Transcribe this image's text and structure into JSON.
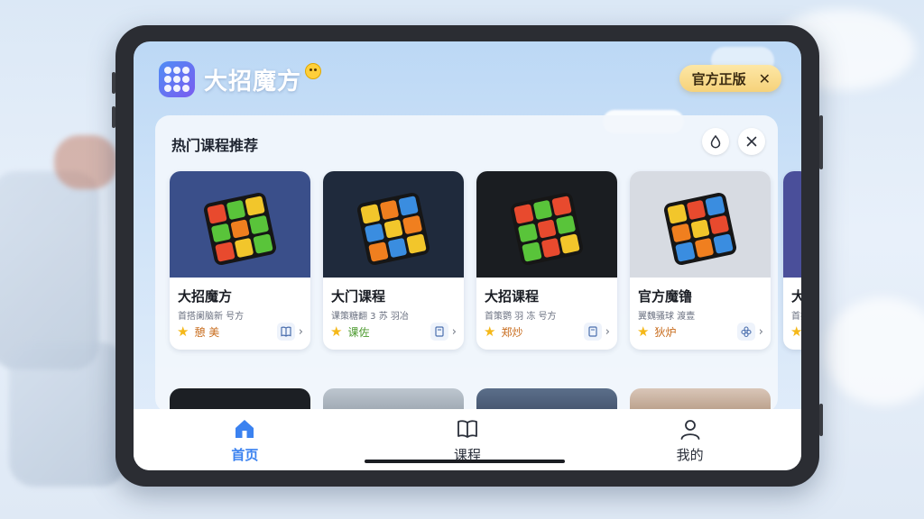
{
  "app": {
    "title": "大招魔方",
    "badge_label": "官方正版",
    "badge_close": "✕"
  },
  "section": {
    "title": "热门课程推荐"
  },
  "cards": [
    {
      "title": "大招魔方",
      "desc": "首搭阑脑新 号方",
      "tag": "憩 美",
      "tag_color": "#c76a1a",
      "icon": "book-open-icon",
      "bg": "#3a4f8a",
      "colors": [
        "#e84a2e",
        "#59c43a",
        "#f2c62b",
        "#59c43a",
        "#f07f1f",
        "#59c43a",
        "#e84a2e",
        "#f2c62b",
        "#59c43a"
      ]
    },
    {
      "title": "大门课程",
      "desc": "课策糖翻 3 苏 羽冶",
      "tag": "课佐",
      "tag_color": "#4c9a2e",
      "icon": "book-icon",
      "bg": "#1f2a3c",
      "colors": [
        "#f2c62b",
        "#f07f1f",
        "#3a8de0",
        "#3a8de0",
        "#f2c62b",
        "#f07f1f",
        "#f07f1f",
        "#3a8de0",
        "#f2c62b"
      ]
    },
    {
      "title": "大招课程",
      "desc": "首策鹦 羽 冻 号方",
      "tag": "郑炒",
      "tag_color": "#c76a1a",
      "icon": "book-icon",
      "bg": "#1a1d21",
      "colors": [
        "#e84a2e",
        "#59c43a",
        "#e84a2e",
        "#59c43a",
        "#e84a2e",
        "#59c43a",
        "#59c43a",
        "#e84a2e",
        "#f2c62b"
      ]
    },
    {
      "title": "官方魔镥",
      "desc": "翼魏骚球 渡壹",
      "tag": "狄炉",
      "tag_color": "#c76a1a",
      "icon": "flower-icon",
      "bg": "#d7dbe2",
      "colors": [
        "#f2c62b",
        "#e84a2e",
        "#3a8de0",
        "#f07f1f",
        "#f2c62b",
        "#e84a2e",
        "#3a8de0",
        "#f07f1f",
        "#3a8de0"
      ]
    }
  ],
  "partial_card": {
    "title": "大招",
    "desc": "首挡"
  },
  "nav": [
    {
      "label": "首页",
      "icon": "home-icon",
      "active": true
    },
    {
      "label": "课程",
      "icon": "book-icon",
      "active": false
    },
    {
      "label": "我的",
      "icon": "user-icon",
      "active": false
    }
  ],
  "colors": {
    "accent": "#3b82f0",
    "badge_bg": "#f6d27a",
    "star": "#f5b819"
  }
}
